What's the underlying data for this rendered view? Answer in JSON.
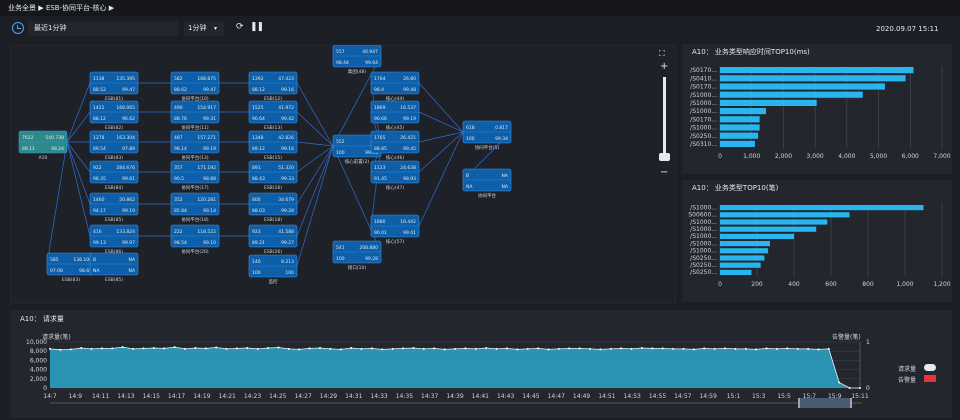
{
  "breadcrumb": "业务全景 ▶ ESB-协同平台-核心 ▶",
  "controls": {
    "range_label": "最近1分钟",
    "unit_label": "1分钟",
    "unit_caret": "▾",
    "refresh_icon": "refresh-icon",
    "pause_icon": "pause-icon"
  },
  "timestamp": "2020.09.07 15:11",
  "topology": {
    "zoom_in": "+",
    "zoom_out": "−",
    "nodes": [
      {
        "label": "A10",
        "v": [
          "7622",
          "540.738",
          "89.11",
          "98.24"
        ]
      },
      {
        "label": "ESB(81)",
        "v": [
          "1138",
          "135.395",
          "88.52",
          "99.47"
        ]
      },
      {
        "label": "ESB(82)",
        "v": [
          "1421",
          "168.065",
          "88.12",
          "96.62"
        ]
      },
      {
        "label": "ESB(83)",
        "v": [
          "1278",
          "163.304",
          "89.54",
          "97.89"
        ]
      },
      {
        "label": "ESB(84)",
        "v": [
          "922",
          "284.676",
          "98.35",
          "99.61"
        ]
      },
      {
        "label": "ESB(85)",
        "v": [
          "1460",
          "50.862",
          "94.17",
          "99.19"
        ]
      },
      {
        "label": "ESB(86)",
        "v": [
          "416",
          "133.824",
          "99.13",
          "99.97"
        ]
      },
      {
        "label": "ESB(83)",
        "v": [
          "585",
          "138.106",
          "97.08",
          "98.69"
        ]
      },
      {
        "label": "ESB(85)",
        "v": [
          "B",
          "NA",
          "NA",
          "NA"
        ]
      },
      {
        "label": "协同平台(10)",
        "v": [
          "582",
          "168.875",
          "88.62",
          "99.47"
        ]
      },
      {
        "label": "协同平台(11)",
        "v": [
          "490",
          "154.917",
          "88.76",
          "99.31"
        ]
      },
      {
        "label": "协同平台(13)",
        "v": [
          "487",
          "157.271",
          "98.14",
          "99.19"
        ]
      },
      {
        "label": "协同平台(17)",
        "v": [
          "357",
          "171.192",
          "90.5",
          "98.88"
        ]
      },
      {
        "label": "协同平台(18)",
        "v": [
          "352",
          "120.281",
          "85.84",
          "99.14"
        ]
      },
      {
        "label": "协同平台(20)",
        "v": [
          "222",
          "118.522",
          "98.54",
          "99.10"
        ]
      },
      {
        "label": "ESB(12)",
        "v": [
          "1392",
          "47.423",
          "88.12",
          "99.16"
        ]
      },
      {
        "label": "ESB(13)",
        "v": [
          "1525",
          "41.972",
          "90.64",
          "99.42"
        ]
      },
      {
        "label": "ESB(15)",
        "v": [
          "1348",
          "42.826",
          "89.12",
          "99.16"
        ]
      },
      {
        "label": "ESB(16)",
        "v": [
          "891",
          "51.320",
          "88.43",
          "99.33"
        ]
      },
      {
        "label": "ESB(18)",
        "v": [
          "800",
          "34.679",
          "88.03",
          "99.28"
        ]
      },
      {
        "label": "ESB(26)",
        "v": [
          "923",
          "41.588",
          "89.21",
          "99.27"
        ]
      },
      {
        "label": "监控",
        "v": [
          "140",
          "8.213",
          "100",
          "100"
        ]
      },
      {
        "label": "集团(48)",
        "v": [
          "557",
          "46.947",
          "98.44",
          "99.64"
        ]
      },
      {
        "label": "核心前置(2)",
        "v": [
          "552",
          "NA",
          "100",
          "99.21"
        ]
      },
      {
        "label": "接口(10)",
        "v": [
          "541",
          "208.880",
          "100",
          "99.28"
        ]
      },
      {
        "label": "核心(44)",
        "v": [
          "1764",
          "26.80",
          "98.4",
          "99.48"
        ]
      },
      {
        "label": "核心(45)",
        "v": [
          "1869",
          "16.537",
          "90.66",
          "99.19"
        ]
      },
      {
        "label": "核心(46)",
        "v": [
          "1765",
          "26.421",
          "88.85",
          "99.45"
        ]
      },
      {
        "label": "核心(47)",
        "v": [
          "1123",
          "24.638",
          "91.45",
          "98.93"
        ]
      },
      {
        "label": "核心(57)",
        "v": [
          "1880",
          "16.442",
          "90.01",
          "99.41"
        ]
      },
      {
        "label": "协同平台(5)",
        "v": [
          "618",
          "0.817",
          "100",
          "99.34"
        ]
      },
      {
        "label": "协同平台",
        "v": [
          "B",
          "NA",
          "NA",
          "NA"
        ]
      }
    ]
  },
  "panel1": {
    "title": "A10： 业务类型响应时间TOP10(ms)"
  },
  "panel2": {
    "title": "A10： 业务类型TOP10(笔)"
  },
  "panel3": {
    "title": "A10： 请求量",
    "left_axis_title": "请求量(笔)",
    "right_axis_title": "告警量(笔)",
    "legend": [
      "请求量",
      "告警量"
    ]
  },
  "colors": {
    "bar": "#29b6f0",
    "area": "#2aa7c9",
    "alarm": "#e8333c",
    "node": "#0c5fa8"
  },
  "chart_data": [
    {
      "type": "bar",
      "orientation": "horizontal",
      "title": "A10： 业务类型响应时间TOP10(ms)",
      "categories": [
        "/S0170...",
        "/S0410...",
        "/S0170...",
        "/S1000...",
        "/S1000...",
        "/S1000...",
        "/S0170...",
        "/S1000...",
        "/S0250...",
        "/S0310..."
      ],
      "values": [
        6100,
        5850,
        5200,
        4500,
        3050,
        1450,
        1250,
        1250,
        1200,
        1100
      ],
      "xlim": [
        0,
        7000
      ],
      "xticks": [
        "0",
        "1,000",
        "2,000",
        "3,000",
        "4,000",
        "5,000",
        "6,000",
        "7,000"
      ],
      "grid": true
    },
    {
      "type": "bar",
      "orientation": "horizontal",
      "title": "A10： 业务类型TOP10(笔)",
      "categories": [
        "/S1000...",
        "S00600...",
        "/S1000...",
        "/S1000...",
        "/S1000...",
        "/S1000...",
        "/S1000...",
        "/S0250...",
        "/S0250...",
        "/S0250..."
      ],
      "values": [
        1100,
        700,
        580,
        520,
        400,
        270,
        260,
        240,
        220,
        170
      ],
      "xlim": [
        0,
        1200
      ],
      "xticks": [
        "0",
        "200",
        "400",
        "600",
        "800",
        "1,000",
        "1,200"
      ],
      "grid": true
    },
    {
      "type": "area",
      "title": "A10： 请求量",
      "ylabel": "请求量(笔)",
      "y2label": "告警量(笔)",
      "ylim": [
        0,
        10000
      ],
      "yticks": [
        "0",
        "2,000",
        "4,000",
        "6,000",
        "8,000",
        "10,000"
      ],
      "y2lim": [
        0,
        1
      ],
      "y2ticks": [
        "0",
        "1"
      ],
      "xticks": [
        "14:7",
        "14:9",
        "14:11",
        "14:13",
        "14:15",
        "14:17",
        "14:19",
        "14:21",
        "14:23",
        "14:25",
        "14:27",
        "14:29",
        "14:31",
        "14:33",
        "14:35",
        "14:37",
        "14:39",
        "14:41",
        "14:43",
        "14:45",
        "14:47",
        "14:49",
        "14:51",
        "14:53",
        "14:55",
        "14:57",
        "14:59",
        "15:1",
        "15:3",
        "15:5",
        "15:7",
        "15:9",
        "15:11"
      ],
      "series": [
        {
          "name": "请求量",
          "values": [
            8500,
            8300,
            8400,
            8700,
            8500,
            8600,
            8600,
            8900,
            8500,
            8600,
            8700,
            8600,
            8900,
            8500,
            8700,
            8600,
            8800,
            8500,
            8600,
            8700,
            8500,
            8700,
            8800,
            8500,
            8400,
            8600,
            8700,
            8500,
            8400,
            8700,
            8500,
            8600,
            8400,
            8500,
            8600,
            8700,
            8500,
            8600,
            8400,
            8500,
            8600,
            8500,
            8700,
            8500,
            8600,
            8400,
            8500,
            8600,
            8400,
            8500,
            8600,
            8600,
            8500,
            8400,
            8500,
            8600,
            8500,
            8700,
            8600,
            8600,
            8500,
            8500,
            8400,
            8600,
            8500,
            8600,
            8500,
            8500,
            8400,
            8600,
            8500,
            8600,
            8500,
            8500,
            8400,
            8500,
            1200,
            0,
            0
          ]
        },
        {
          "name": "告警量",
          "values": []
        }
      ],
      "grid": true
    }
  ]
}
